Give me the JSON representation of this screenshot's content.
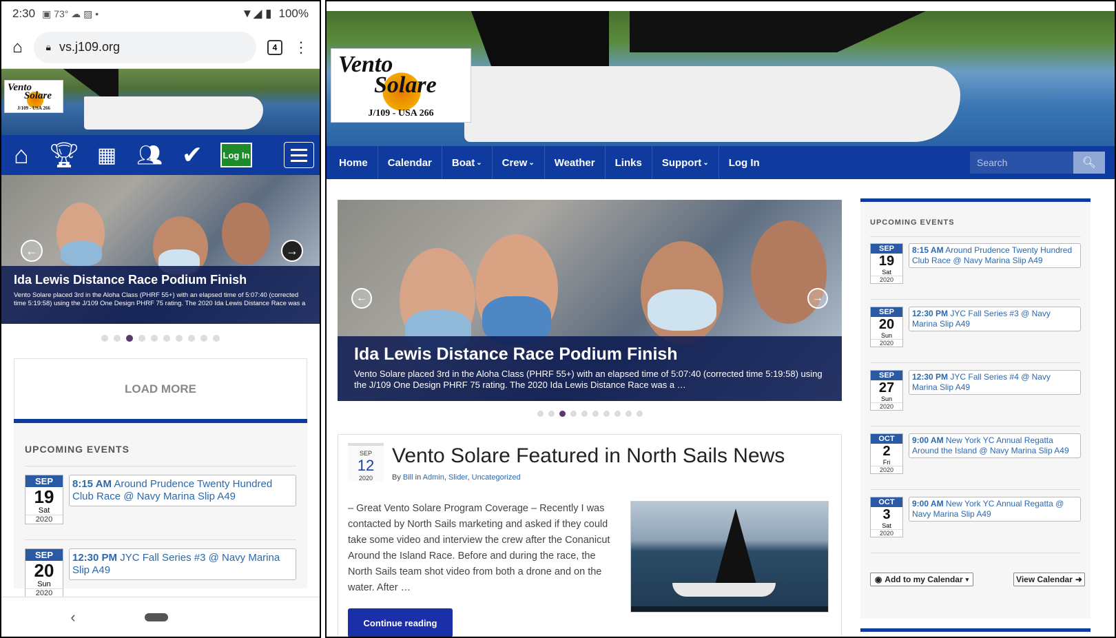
{
  "phone": {
    "status": {
      "time": "2:30",
      "temp": "73°",
      "battery": "100%"
    },
    "url": "vs.j109.org",
    "tab_count": "4",
    "logo": {
      "line1": "Vento",
      "line2": "Solare",
      "sub": "J/109 - USA 266"
    },
    "login_label": "Log In",
    "slide": {
      "title": "Ida Lewis Distance Race Podium Finish",
      "text": "Vento Solare placed 3rd in the Aloha Class (PHRF 55+) with an elapsed time of 5:07:40 (corrected time 5:19:58) using the J/109 One Design PHRF 75 rating. The 2020 Ida Lewis Distance Race was a …"
    },
    "load_more": "LOAD MORE",
    "events_title": "UPCOMING EVENTS",
    "events": [
      {
        "month": "SEP",
        "day": "19",
        "dow": "Sat",
        "year": "2020",
        "time": "8:15 AM",
        "title": "Around Prudence Twenty Hundred Club Race @ Navy Marina Slip A49"
      },
      {
        "month": "SEP",
        "day": "20",
        "dow": "Sun",
        "year": "2020",
        "time": "12:30 PM",
        "title": "JYC Fall Series #3 @ Navy Marina Slip A49"
      }
    ]
  },
  "desktop": {
    "logo": {
      "line1": "Vento",
      "line2": "Solare",
      "sub": "J/109 - USA 266"
    },
    "nav": [
      "Home",
      "Calendar",
      "Boat",
      "Crew",
      "Weather",
      "Links",
      "Support",
      "Log In"
    ],
    "nav_dropdown_marker": "⌄",
    "search_placeholder": "Search",
    "slide": {
      "title": "Ida Lewis Distance Race Podium Finish",
      "text": "Vento Solare placed 3rd in the Aloha Class (PHRF 55+) with an elapsed time of 5:07:40 (corrected time 5:19:58) using the J/109 One Design PHRF 75 rating. The 2020 Ida Lewis Distance Race was a …"
    },
    "post": {
      "month": "SEP",
      "day": "12",
      "year": "2020",
      "title": "Vento Solare Featured in North Sails News",
      "by": "By",
      "author": "Bill",
      "in": "in",
      "categories": [
        "Admin",
        "Slider",
        "Uncategorized"
      ],
      "excerpt": "– Great Vento Solare Program Coverage –   Recently I was contacted by North Sails marketing and asked if they could take some video and interview the crew after the Conanicut Around the Island Race.  Before and during the race, the North Sails team shot video from both a drone and on the water.  After …",
      "continue": "Continue reading"
    },
    "events_title": "UPCOMING EVENTS",
    "events": [
      {
        "month": "SEP",
        "day": "19",
        "dow": "Sat",
        "year": "2020",
        "time": "8:15 AM",
        "title": "Around Prudence Twenty Hundred Club Race @ Navy Marina Slip A49"
      },
      {
        "month": "SEP",
        "day": "20",
        "dow": "Sun",
        "year": "2020",
        "time": "12:30 PM",
        "title": "JYC Fall Series #3 @ Navy Marina Slip A49"
      },
      {
        "month": "SEP",
        "day": "27",
        "dow": "Sun",
        "year": "2020",
        "time": "12:30 PM",
        "title": "JYC Fall Series #4 @ Navy Marina Slip A49"
      },
      {
        "month": "OCT",
        "day": "2",
        "dow": "Fri",
        "year": "2020",
        "time": "9:00 AM",
        "title": "New York YC Annual Regatta Around the Island @ Navy Marina Slip A49"
      },
      {
        "month": "OCT",
        "day": "3",
        "dow": "Sat",
        "year": "2020",
        "time": "9:00 AM",
        "title": "New York YC Annual Regatta @ Navy Marina Slip A49"
      }
    ],
    "add_calendar": "Add to my Calendar",
    "view_calendar": "View Calendar",
    "pager_count": 10,
    "pager_active": 3
  },
  "colors": {
    "nav": "#0f3b9e",
    "link": "#2a68b0",
    "event_month": "#2a5aa4"
  },
  "icons": [
    "home-icon",
    "trophy-icon",
    "calendar-icon",
    "crew-icon",
    "check-icon",
    "menu-icon",
    "search-icon",
    "rss-icon",
    "arrow-right-icon",
    "arrow-left-icon",
    "lock-icon"
  ]
}
